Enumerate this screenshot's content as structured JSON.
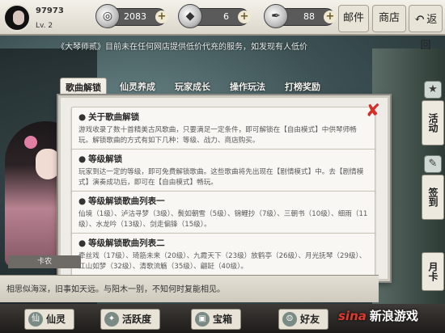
{
  "player": {
    "id": "97973",
    "level": "Lv. 2"
  },
  "resources": [
    {
      "name": "silver-coin-icon",
      "value": "2083"
    },
    {
      "name": "jade-icon",
      "value": "6"
    },
    {
      "name": "ink-icon",
      "value": "88"
    }
  ],
  "top_buttons": {
    "mail": "邮件",
    "shop": "商店",
    "back": "返回"
  },
  "marquee": "《大琴师贰》目前未在任何网店提供低价代充的服务，如发现有人低价",
  "tabs": [
    "歌曲解锁",
    "仙灵养成",
    "玩家成长",
    "操作玩法",
    "打榜奖励"
  ],
  "cards": [
    {
      "title": "关于歌曲解锁",
      "body": "游戏收录了数十首精美古风歌曲，只要满足一定条件，即可解锁在【自由模式】中供琴师畅玩。解锁歌曲的方式有如下几种：等级、战力、商店购买。"
    },
    {
      "title": "等级解锁",
      "body": "玩家到达一定的等级，即可免费解锁歌曲。这些歌曲将先出现在【剧情模式】中。去【剧情模式】演奏成功后，即可在【自由模式】畅玩。"
    },
    {
      "title": "等级解锁歌曲列表一",
      "body": "仙境（1级）、泸沽寻梦（3级）、鬓如朝雪（5级）、锦鲤抄（7级）、三朝书（10级）、细雨（11级）、水龙吟（13级）、剑走偏锋（15级）。"
    },
    {
      "title": "等级解锁歌曲列表二",
      "body": "牵丝戏（17级）、琦筋未来（20级）、九霞天下（23级）放鹤亭（26级）、月光抚琴（29级）、江山如梦（32级）、清歌流觞（35级）、翩跹（40级）。"
    }
  ],
  "side_buttons": [
    "活动",
    "签到",
    "月卡"
  ],
  "card_label": "卡农",
  "chat_text": "相思似海深，旧事如天远。与阳木一别，不知何时复能相见。",
  "bottom_buttons": [
    "仙灵",
    "活跃度",
    "宝箱",
    "好友"
  ],
  "watermark": {
    "brand": "sina",
    "text": "新浪游戏"
  }
}
